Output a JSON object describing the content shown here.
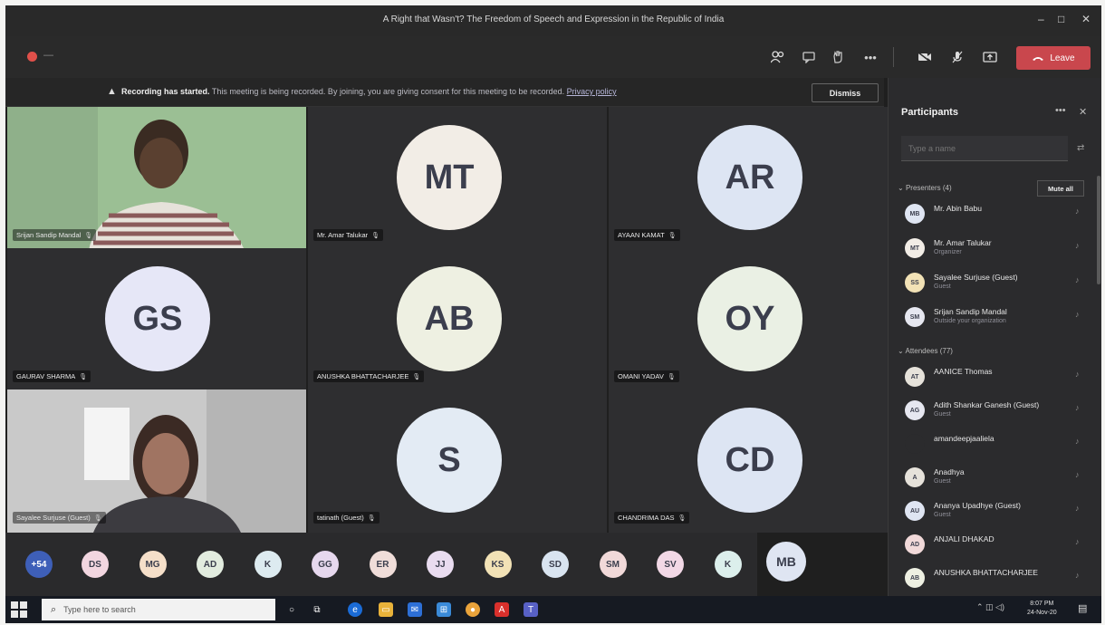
{
  "window": {
    "title": "A Right that Wasn't? The Freedom of Speech and Expression in the Republic of India",
    "minimize": "–",
    "maximize": "□",
    "close": "✕"
  },
  "toolbar": {
    "record_dash": "—",
    "more": "•••",
    "leave_label": "Leave"
  },
  "banner": {
    "bold": "Recording has started.",
    "text": " This meeting is being recorded. By joining, you are giving consent for this meeting to be recorded. ",
    "link": "Privacy policy",
    "dismiss": "Dismiss"
  },
  "tiles": [
    {
      "name": "Srijan Sandip Mandal",
      "initials": "",
      "video": true,
      "bg": "#9bbf94"
    },
    {
      "name": "Mr. Amar Talukar",
      "initials": "MT",
      "color": "#f2ede6"
    },
    {
      "name": "AYAAN KAMAT",
      "initials": "AR",
      "color": "#dde5f3"
    },
    {
      "name": "GAURAV SHARMA",
      "initials": "GS",
      "color": "#e6e7f7"
    },
    {
      "name": "ANUSHKA BHATTACHARJEE",
      "initials": "AB",
      "color": "#eef0e2"
    },
    {
      "name": "OMANI YADAV",
      "initials": "OY",
      "color": "#eaf0e4"
    },
    {
      "name": "Sayalee Surjuse (Guest)",
      "initials": "",
      "video": true,
      "bg": "#c9c9c9"
    },
    {
      "name": "tatinath (Guest)",
      "initials": "S",
      "color": "#e3ebf4"
    },
    {
      "name": "CHANDRIMA DAS",
      "initials": "CD",
      "color": "#dde5f3"
    }
  ],
  "strip": {
    "more_count": "+54",
    "avatars": [
      {
        "initials": "DS",
        "color": "#f2d6e0"
      },
      {
        "initials": "MG",
        "color": "#f5dfc9"
      },
      {
        "initials": "AD",
        "color": "#e2ecdf"
      },
      {
        "initials": "K",
        "color": "#ddebf0"
      },
      {
        "initials": "GG",
        "color": "#e6d8ee"
      },
      {
        "initials": "ER",
        "color": "#f0ddd9"
      },
      {
        "initials": "JJ",
        "color": "#e9dcf0"
      },
      {
        "initials": "KS",
        "color": "#f2e2b6"
      },
      {
        "initials": "SD",
        "color": "#d9e4f0"
      },
      {
        "initials": "SM",
        "color": "#f1d9d9"
      },
      {
        "initials": "SV",
        "color": "#f2d8e6"
      },
      {
        "initials": "K",
        "color": "#dcefec"
      }
    ],
    "mb": "MB"
  },
  "panel": {
    "title": "Participants",
    "more": "•••",
    "close": "✕",
    "search_placeholder": "Type a name",
    "presenters_header": "Presenters (4)",
    "mute_all": "Mute all",
    "attendees_header": "Attendees (77)",
    "presenters": [
      {
        "initials": "MB",
        "name": "Mr. Abin Babu",
        "role": "",
        "color": "#dfe5f2"
      },
      {
        "initials": "MT",
        "name": "Mr. Amar Talukar",
        "role": "Organizer",
        "color": "#f2ede6"
      },
      {
        "initials": "SS",
        "name": "Sayalee Surjuse (Guest)",
        "role": "Guest",
        "color": "#f2e2b6"
      },
      {
        "initials": "SM",
        "name": "Srijan Sandip Mandal",
        "role": "Outside your organization",
        "color": "#e6e7f0"
      }
    ],
    "attendees": [
      {
        "initials": "AT",
        "name": "AANICE Thomas",
        "role": "",
        "color": "#e6e2da"
      },
      {
        "initials": "AG",
        "name": "Adith Shankar Ganesh (Guest)",
        "role": "Guest",
        "color": "#e6e7f0"
      },
      {
        "initials": "",
        "name": "amandeepjaaliela",
        "role": "",
        "color": "#2b2b2d"
      },
      {
        "initials": "A",
        "name": "Anadhya",
        "role": "Guest",
        "color": "#e6e2da"
      },
      {
        "initials": "AU",
        "name": "Ananya Upadhye (Guest)",
        "role": "Guest",
        "color": "#dfe5f2"
      },
      {
        "initials": "AD",
        "name": "ANJALI DHAKAD",
        "role": "",
        "color": "#f1d9d9"
      },
      {
        "initials": "AB",
        "name": "ANUSHKA BHATTACHARJEE",
        "role": "",
        "color": "#eef0e2"
      }
    ]
  },
  "taskbar": {
    "search_placeholder": "Type here to search",
    "tray": "⌃ ◫ ◁)",
    "time": "8:07 PM",
    "date": "24-Nov-20"
  }
}
